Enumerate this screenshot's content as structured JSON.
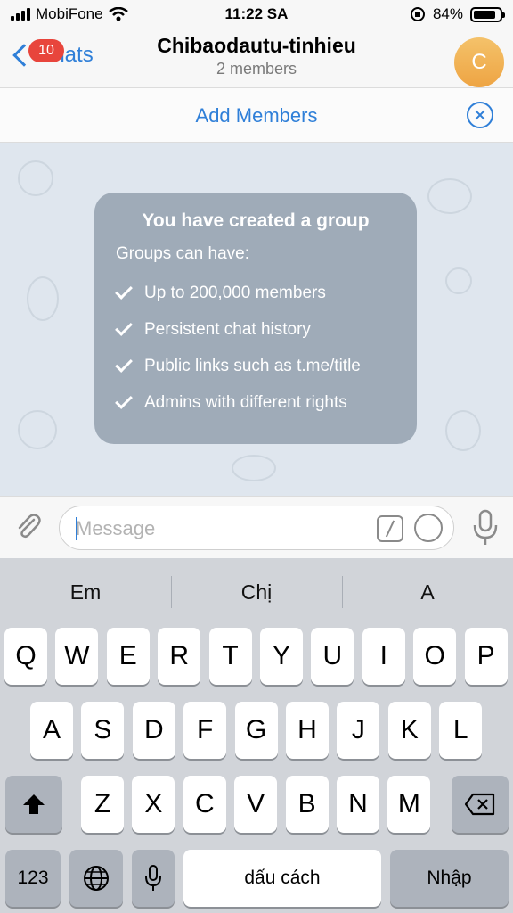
{
  "status_bar": {
    "carrier": "MobiFone",
    "time": "11:22 SA",
    "battery": "84%",
    "battery_level": 0.84
  },
  "nav": {
    "back_label": "Chats",
    "unread_badge": "10",
    "title": "Chibaodautu-tinhieu",
    "subtitle": "2 members",
    "avatar_letter": "C"
  },
  "add_members": {
    "label": "Add Members"
  },
  "info_card": {
    "title": "You have created a group",
    "subtitle": "Groups can have:",
    "features": [
      "Up to 200,000 members",
      "Persistent chat history",
      "Public links such as t.me/title",
      "Admins with different rights"
    ]
  },
  "composer": {
    "placeholder": "Message"
  },
  "keyboard": {
    "suggestions": [
      "Em",
      "Chị",
      "A"
    ],
    "row1": [
      "Q",
      "W",
      "E",
      "R",
      "T",
      "Y",
      "U",
      "I",
      "O",
      "P"
    ],
    "row2": [
      "A",
      "S",
      "D",
      "F",
      "G",
      "H",
      "J",
      "K",
      "L"
    ],
    "row3": [
      "Z",
      "X",
      "C",
      "V",
      "B",
      "N",
      "M"
    ],
    "numbers_key": "123",
    "space_key": "dấu cách",
    "return_key": "Nhập"
  },
  "colors": {
    "accent": "#2f7fd8",
    "badge": "#e8453c",
    "avatar": "#eea443",
    "chat_bg": "#dfe6ee"
  }
}
